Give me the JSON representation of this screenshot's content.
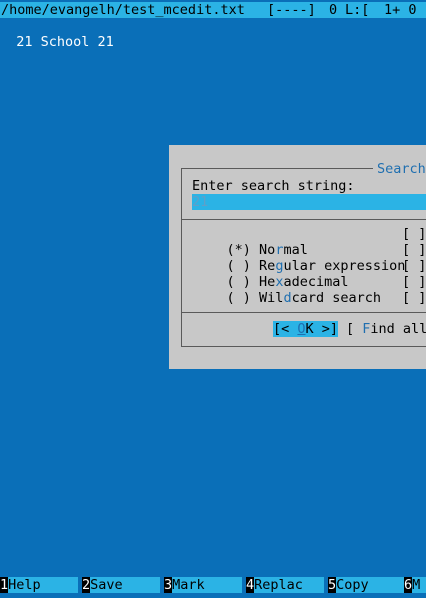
{
  "status": {
    "path": "/home/evangelh/test_mcedit.txt",
    "flags": "[----]",
    "col": "0",
    "line_label": "L:[",
    "line_info": "1+ 0"
  },
  "editor": {
    "line1": "21 School 21"
  },
  "dialog": {
    "title": "Search",
    "prompt": "Enter search string:",
    "input_value": "21",
    "options": [
      {
        "mark": "(*)",
        "pre": "No",
        "hot": "r",
        "post": "mal"
      },
      {
        "mark": "( )",
        "pre": "Re",
        "hot": "g",
        "post": "ular expression"
      },
      {
        "mark": "( )",
        "pre": "He",
        "hot": "x",
        "post": "adecimal"
      },
      {
        "mark": "( )",
        "pre": "Wil",
        "hot": "d",
        "post": "card search"
      }
    ],
    "checkboxes": [
      "[ ]",
      "[ ]",
      "[ ]",
      "[ ]",
      "[ ]"
    ],
    "ok_button": {
      "pre": "[< ",
      "hot": "O",
      "post": "K >]"
    },
    "find_all_button": {
      "pre": "[ ",
      "hot": "F",
      "post": "ind all"
    }
  },
  "buttonbar": [
    {
      "num": "1",
      "label": "Help"
    },
    {
      "num": "2",
      "label": "Save"
    },
    {
      "num": "3",
      "label": "Mark"
    },
    {
      "num": "4",
      "label": "Replac"
    },
    {
      "num": "5",
      "label": "Copy"
    },
    {
      "num": "6",
      "label": "M"
    }
  ]
}
